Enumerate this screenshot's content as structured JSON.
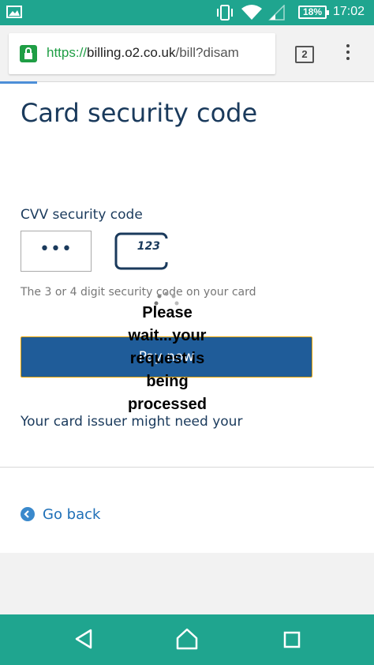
{
  "status_bar": {
    "battery": "18%",
    "time": "17:02"
  },
  "browser": {
    "url_scheme": "https://",
    "url_host": "billing.o2.co.uk",
    "url_path": "/bill?disam",
    "tab_count": "2"
  },
  "page": {
    "title": "Card security code",
    "cvv_label": "CVV security code",
    "cvv_value": "•••",
    "card_hint_number": "123",
    "hint": "The 3 or 4 digit security code on your card",
    "pay_button_label": "Pay now",
    "loading_message": "Please wait...your request is being processed",
    "issuer_text": "Your card issuer might need your",
    "go_back_label": "Go back"
  },
  "colors": {
    "status_bar": "#1fa58f",
    "primary_text": "#1a3a5c",
    "button": "#1f5c99",
    "button_border": "#e6a200",
    "link": "#1e6fb7",
    "secure_green": "#1f9e45"
  }
}
